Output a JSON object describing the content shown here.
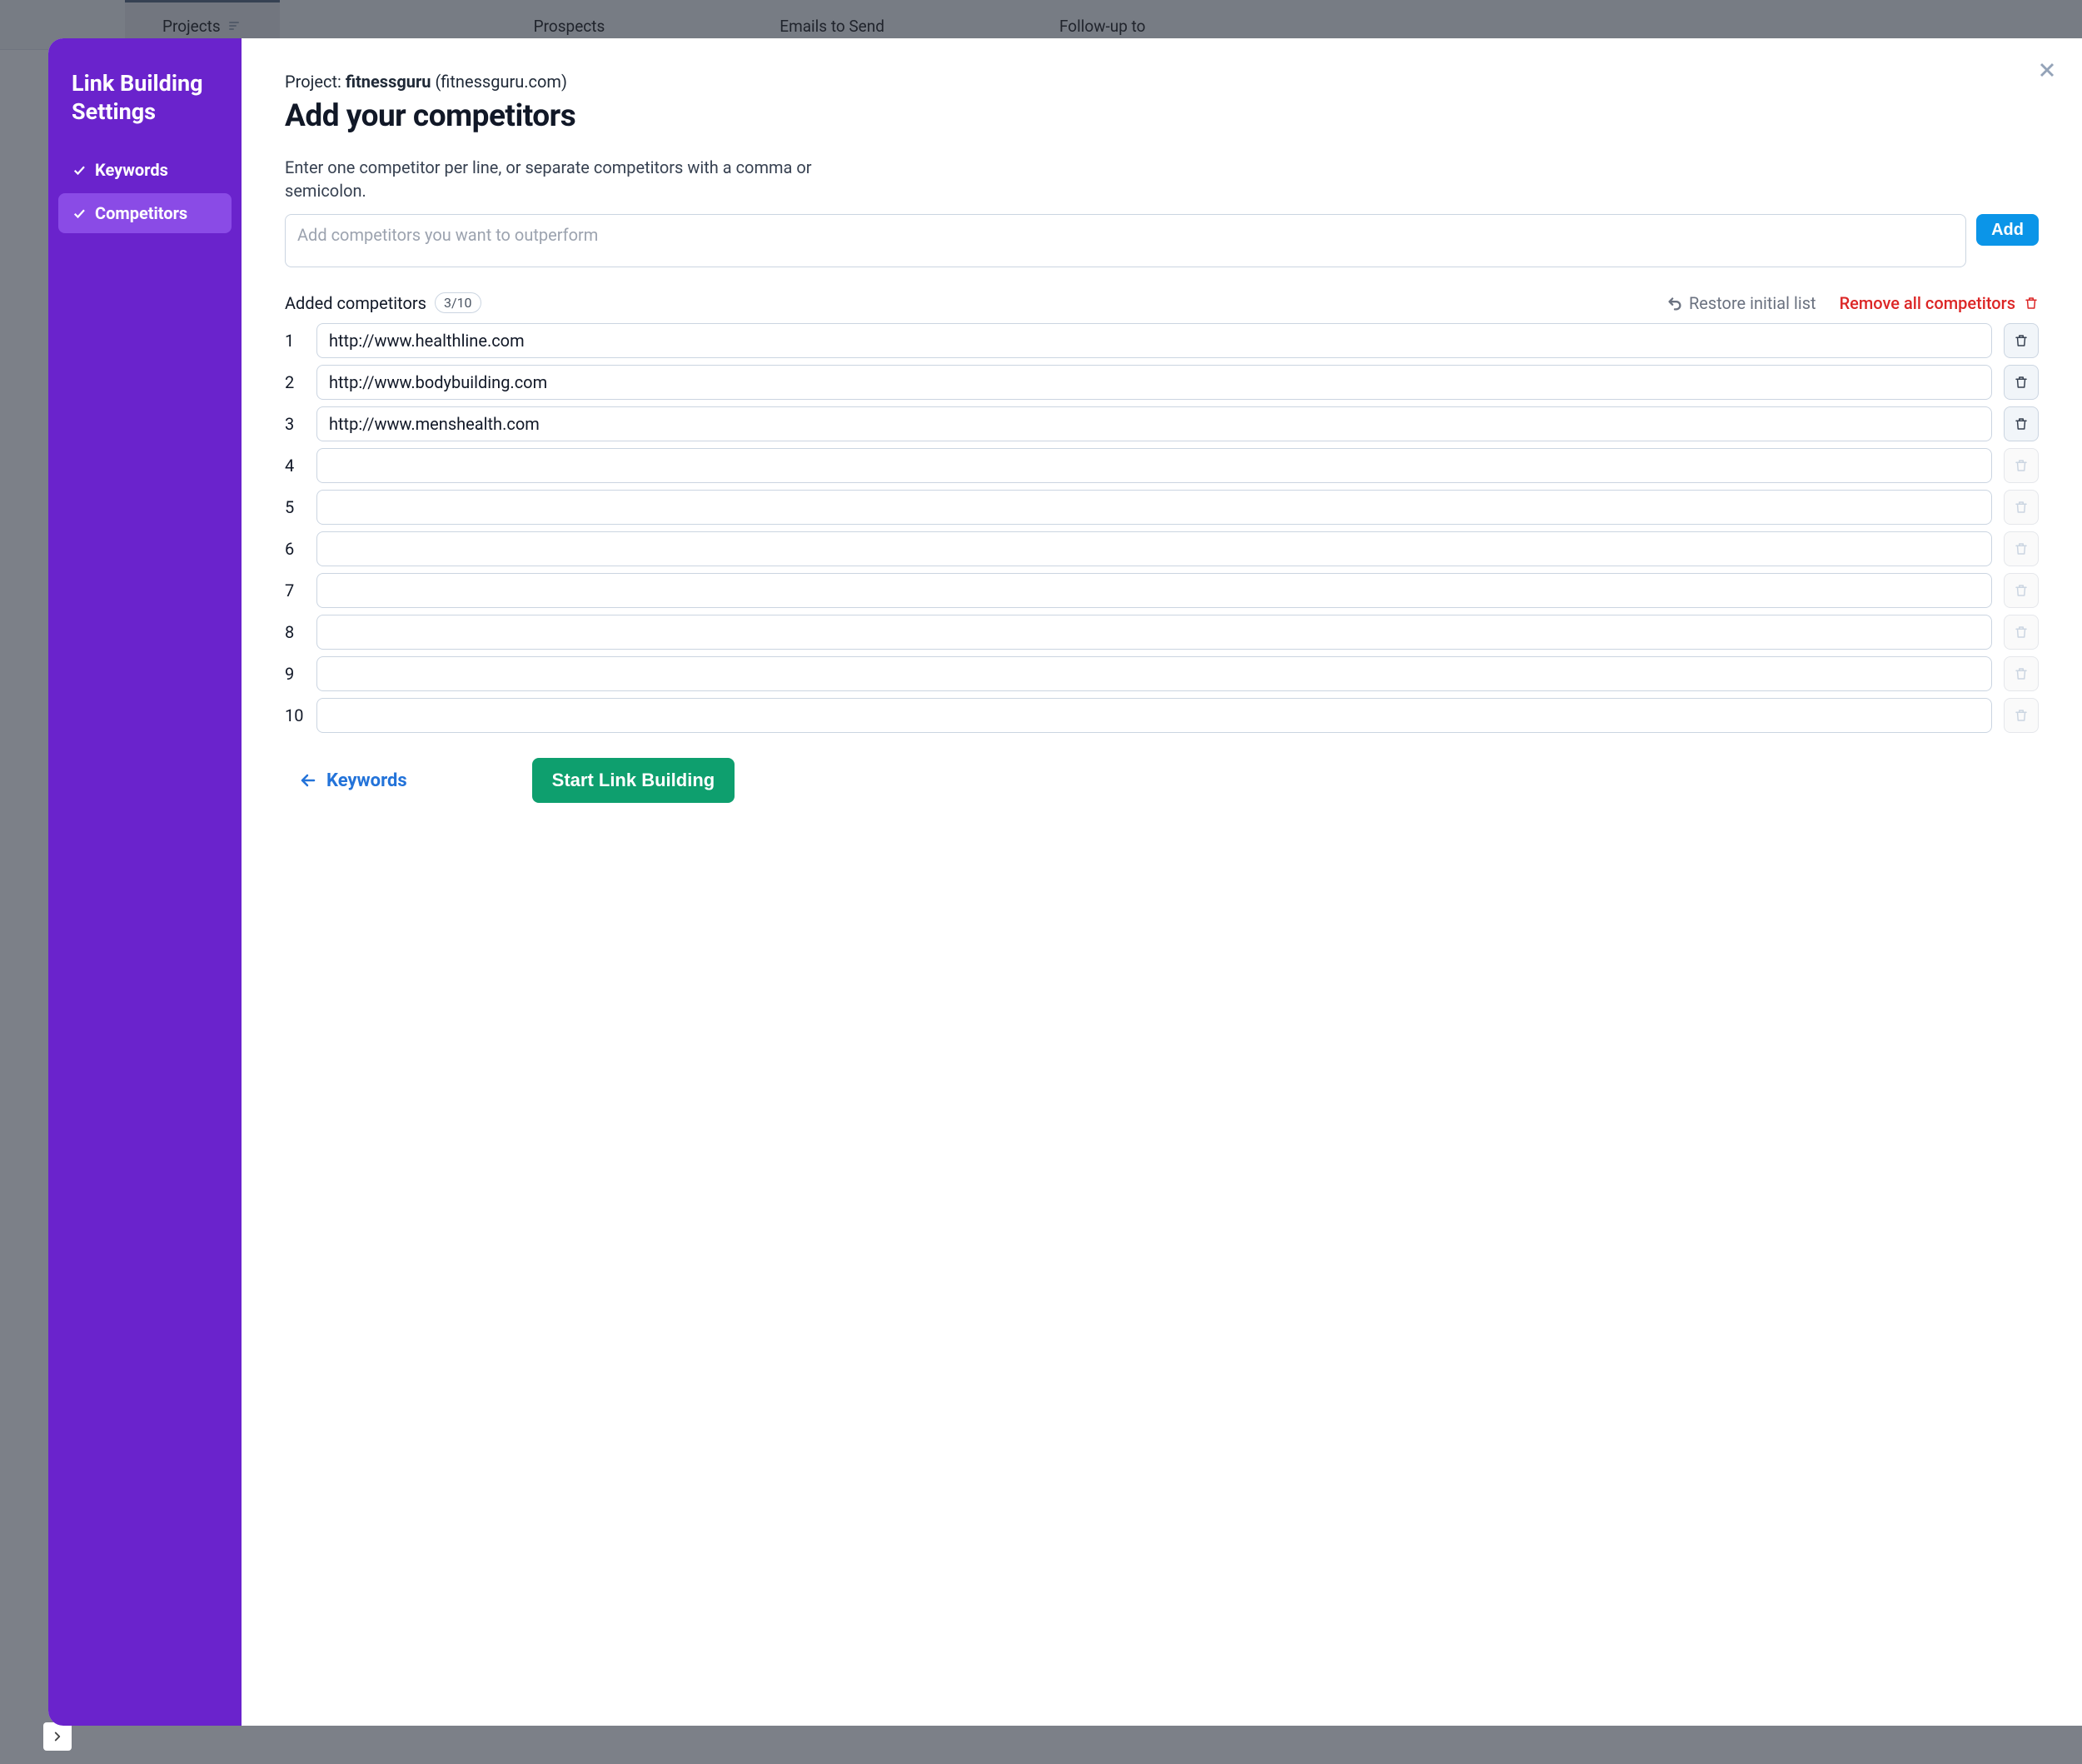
{
  "bg_tabs": {
    "projects": "Projects",
    "prospects": "Prospects",
    "emails": "Emails to Send",
    "followup": "Follow-up to"
  },
  "sidebar": {
    "title_l1": "Link Building",
    "title_l2": "Settings",
    "step_keywords": "Keywords",
    "step_competitors": "Competitors"
  },
  "main": {
    "project_label": "Project: ",
    "project_name": "fitnessguru",
    "project_domain": " (fitnessguru.com)",
    "title": "Add your competitors",
    "desc": "Enter one competitor per line, or separate competitors with a comma or semicolon.",
    "add_placeholder": "Add competitors you want to outperform",
    "add_button": "Add",
    "added_label": "Added competitors",
    "count": "3/10",
    "restore": "Restore initial list",
    "remove_all": "Remove all competitors",
    "rows": [
      {
        "n": "1",
        "v": "http://www.healthline.com"
      },
      {
        "n": "2",
        "v": "http://www.bodybuilding.com"
      },
      {
        "n": "3",
        "v": "http://www.menshealth.com"
      },
      {
        "n": "4",
        "v": ""
      },
      {
        "n": "5",
        "v": ""
      },
      {
        "n": "6",
        "v": ""
      },
      {
        "n": "7",
        "v": ""
      },
      {
        "n": "8",
        "v": ""
      },
      {
        "n": "9",
        "v": ""
      },
      {
        "n": "10",
        "v": ""
      }
    ],
    "back": "Keywords",
    "start": "Start Link Building"
  }
}
